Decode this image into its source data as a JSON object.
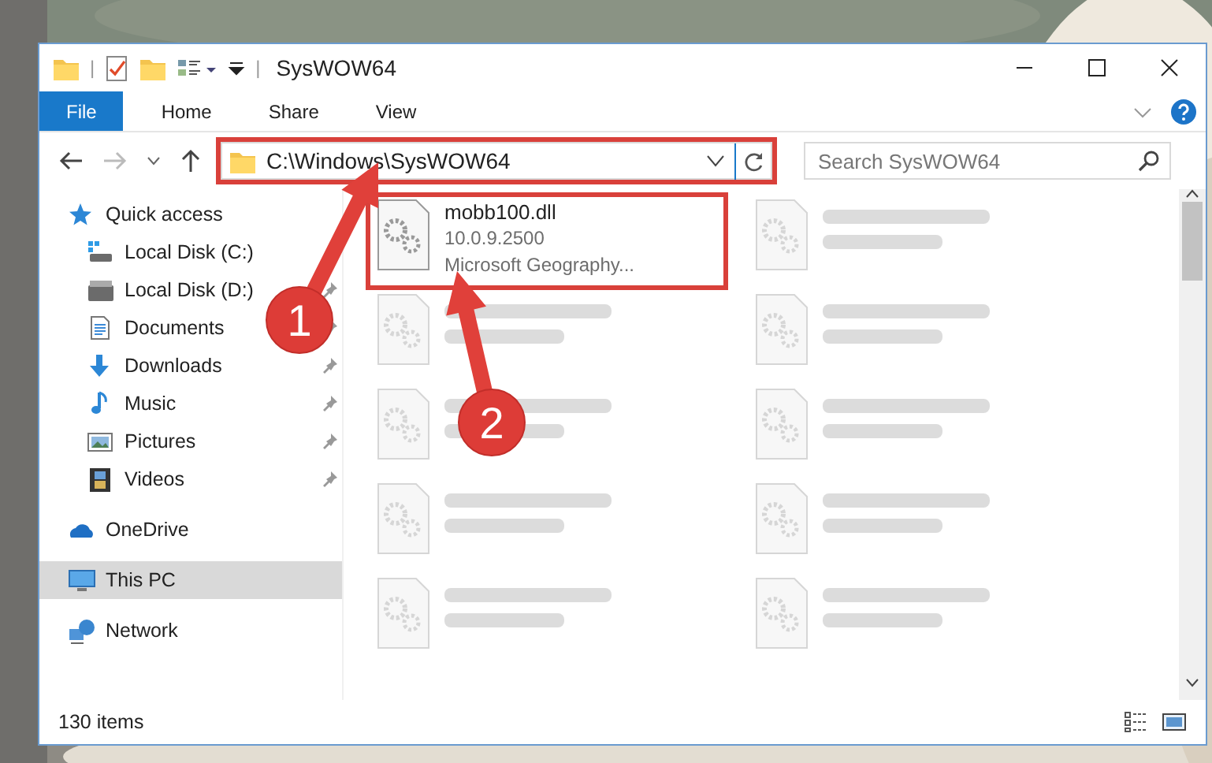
{
  "window": {
    "title": "SysWOW64",
    "quick_toolbar": [
      "|",
      "|"
    ]
  },
  "ribbon_tabs": [
    {
      "label": "File",
      "selected": true
    },
    {
      "label": "Home",
      "selected": false
    },
    {
      "label": "Share",
      "selected": false
    },
    {
      "label": "View",
      "selected": false
    }
  ],
  "address_bar": {
    "path": "C:\\Windows\\SysWOW64",
    "highlighted": true
  },
  "search": {
    "placeholder": "Search SysWOW64"
  },
  "navigation": [
    {
      "label": "Quick access",
      "kind": "star",
      "selected": false,
      "children": [
        {
          "label": "Local Disk (C:)",
          "kind": "osdisk",
          "pinned": false
        },
        {
          "label": "Local Disk (D:)",
          "kind": "disk",
          "pinned": true
        },
        {
          "label": "Documents",
          "kind": "documents",
          "pinned": true
        },
        {
          "label": "Downloads",
          "kind": "downloads",
          "pinned": true
        },
        {
          "label": "Music",
          "kind": "music",
          "pinned": true
        },
        {
          "label": "Pictures",
          "kind": "pictures",
          "pinned": true
        },
        {
          "label": "Videos",
          "kind": "videos",
          "pinned": true
        }
      ]
    },
    {
      "label": "OneDrive",
      "kind": "cloud",
      "selected": false
    },
    {
      "label": "This PC",
      "kind": "pc",
      "selected": true
    },
    {
      "label": "Network",
      "kind": "network",
      "selected": false
    }
  ],
  "files": [
    {
      "kind": "file",
      "name": "mobb100.dll",
      "details": [
        "10.0.9.2500",
        "Microsoft Geography..."
      ],
      "highlighted": true
    },
    {
      "kind": "blurred"
    },
    {
      "kind": "blurred"
    },
    {
      "kind": "blurred"
    },
    {
      "kind": "blurred"
    },
    {
      "kind": "blurred"
    },
    {
      "kind": "blurred"
    },
    {
      "kind": "blurred"
    },
    {
      "kind": "blurred"
    },
    {
      "kind": "blurred"
    }
  ],
  "status_bar": {
    "item_count": "130 items"
  },
  "annotations": [
    {
      "label": "1"
    },
    {
      "label": "2"
    }
  ]
}
